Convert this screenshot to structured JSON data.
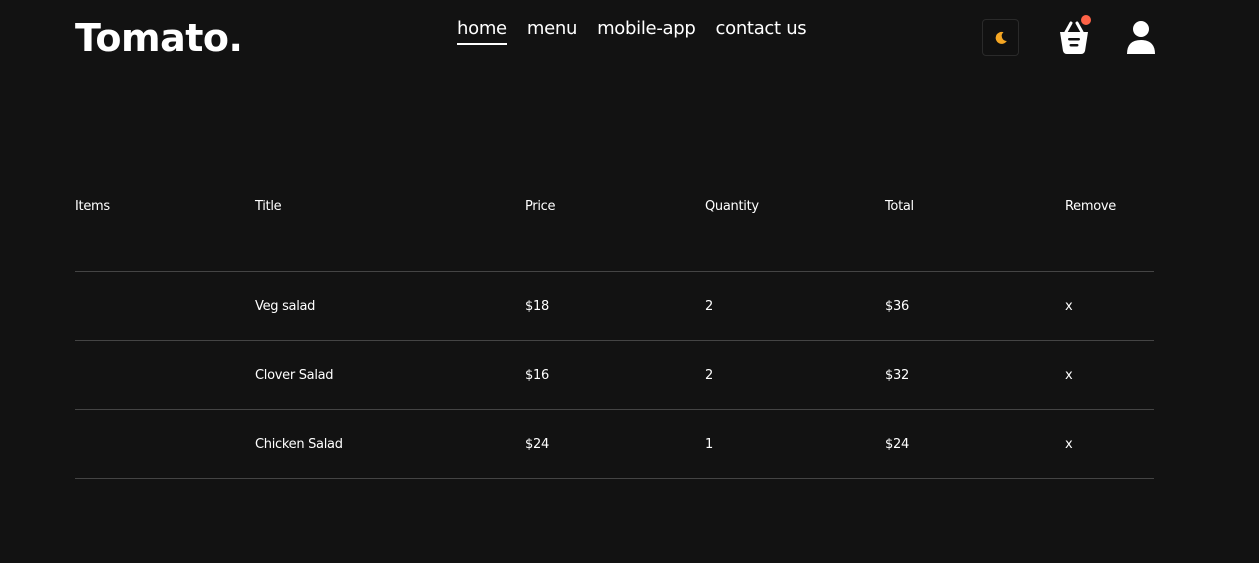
{
  "brand": {
    "logo": "Tomato."
  },
  "nav": {
    "items": [
      {
        "label": "home",
        "active": true
      },
      {
        "label": "menu",
        "active": false
      },
      {
        "label": "mobile-app",
        "active": false
      },
      {
        "label": "contact us",
        "active": false
      }
    ]
  },
  "icons": {
    "theme": "moon-icon",
    "basket": "basket-icon",
    "profile": "user-icon"
  },
  "colors": {
    "background": "#121212",
    "text": "#ffffff",
    "accent_dot": "#ff6347",
    "moon": "#f5a623",
    "divider": "#444444"
  },
  "cart": {
    "headers": [
      "Items",
      "Title",
      "Price",
      "Quantity",
      "Total",
      "Remove"
    ],
    "rows": [
      {
        "title": "Veg salad",
        "price": "$18",
        "quantity": "2",
        "total": "$36",
        "remove": "x"
      },
      {
        "title": "Clover Salad",
        "price": "$16",
        "quantity": "2",
        "total": "$32",
        "remove": "x"
      },
      {
        "title": "Chicken Salad",
        "price": "$24",
        "quantity": "1",
        "total": "$24",
        "remove": "x"
      }
    ]
  }
}
